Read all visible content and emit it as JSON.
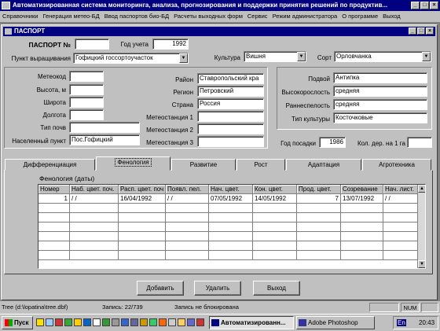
{
  "app": {
    "title": "Автоматизированная система мониторинга, анализа, прогнозирования и поддержки принятия решений по продуктив...",
    "window_buttons": [
      "_",
      "□",
      "×"
    ]
  },
  "menu": [
    "Справочники",
    "Генерация метео-БД",
    "Ввод паспортов био-БД",
    "Расчеты выходных форм",
    "Сервис",
    "Режим администратора",
    "О программе",
    "Выход"
  ],
  "form": {
    "title": "ПАСПОРТ",
    "window_buttons": [
      "_",
      "□",
      "×"
    ],
    "passport_label": "ПАСПОРТ №",
    "passport_value": "",
    "year_label": "Год учета",
    "year_value": "1992",
    "place_label": "Пункт выращивания",
    "place_value": "Гофицкий госсортоучасток",
    "culture_label": "Культура",
    "culture_value": "Вишня",
    "variety_label": "Сорт",
    "variety_value": "Орловчанка"
  },
  "location": {
    "meteocode_label": "Метеокод",
    "meteocode_value": "",
    "height_label": "Высота, м",
    "height_value": "",
    "latitude_label": "Широта",
    "latitude_value": "",
    "longitude_label": "Долгота",
    "longitude_value": "",
    "soil_label": "Тип почв",
    "soil_value": "",
    "settlement_label": "Населенный пункт",
    "settlement_value": "Пос.Гофицкий",
    "district_label": "Район",
    "district_value": "Ставропольский кра",
    "region_label": "Регион",
    "region_value": "Петровский",
    "country_label": "Страна",
    "country_value": "Россия",
    "ms1_label": "Метеостанция 1",
    "ms1_value": "",
    "ms2_label": "Метеостанция 2",
    "ms2_value": "",
    "ms3_label": "Метеостанция 3",
    "ms3_value": ""
  },
  "variety": {
    "rootstock_label": "Подвой",
    "rootstock_value": "Антипка",
    "precocity_label": "Высокорослость",
    "precocity_value": "средняя",
    "ripening_label": "Раннеспелость",
    "ripening_value": "средняя",
    "type_label": "Тип культуры",
    "type_value": "Косточковые"
  },
  "planting": {
    "year_label": "Год посадки",
    "year_value": "1986",
    "trees_label": "Кол. дер. на 1 га",
    "trees_value": ""
  },
  "tabs": [
    "Дифференциация",
    "Фенология",
    "Развитие",
    "Рост",
    "Адаптация",
    "Агротехника"
  ],
  "phenology": {
    "title": "Фенология (даты)",
    "columns": [
      "Номер",
      "Наб. цвет. поч.",
      "Расп. цвет. поч",
      "Появл. пел.",
      "Нач. цвет.",
      "Кон. цвет.",
      "Прод. цвет.",
      "Созревание",
      "Нач. лист."
    ],
    "rows": [
      [
        "1",
        "/ /",
        "16/04/1992",
        "/ /",
        "07/05/1992",
        "14/05/1992",
        "7",
        "13/07/1992",
        "/ /"
      ]
    ]
  },
  "buttons": {
    "add": "Добавить",
    "delete": "Удалить",
    "exit": "Выход"
  },
  "status": {
    "table": "Tree (d:\\lopatina\\tree.dbf)",
    "record": "Запись: 22/739",
    "lock": "Запись не блокирована",
    "num": "NUM"
  },
  "taskbar": {
    "start": "Пуск",
    "tasks": [
      "Автоматизированн...",
      "Adobe Photoshop"
    ],
    "lang": "En",
    "time": "20:43"
  }
}
